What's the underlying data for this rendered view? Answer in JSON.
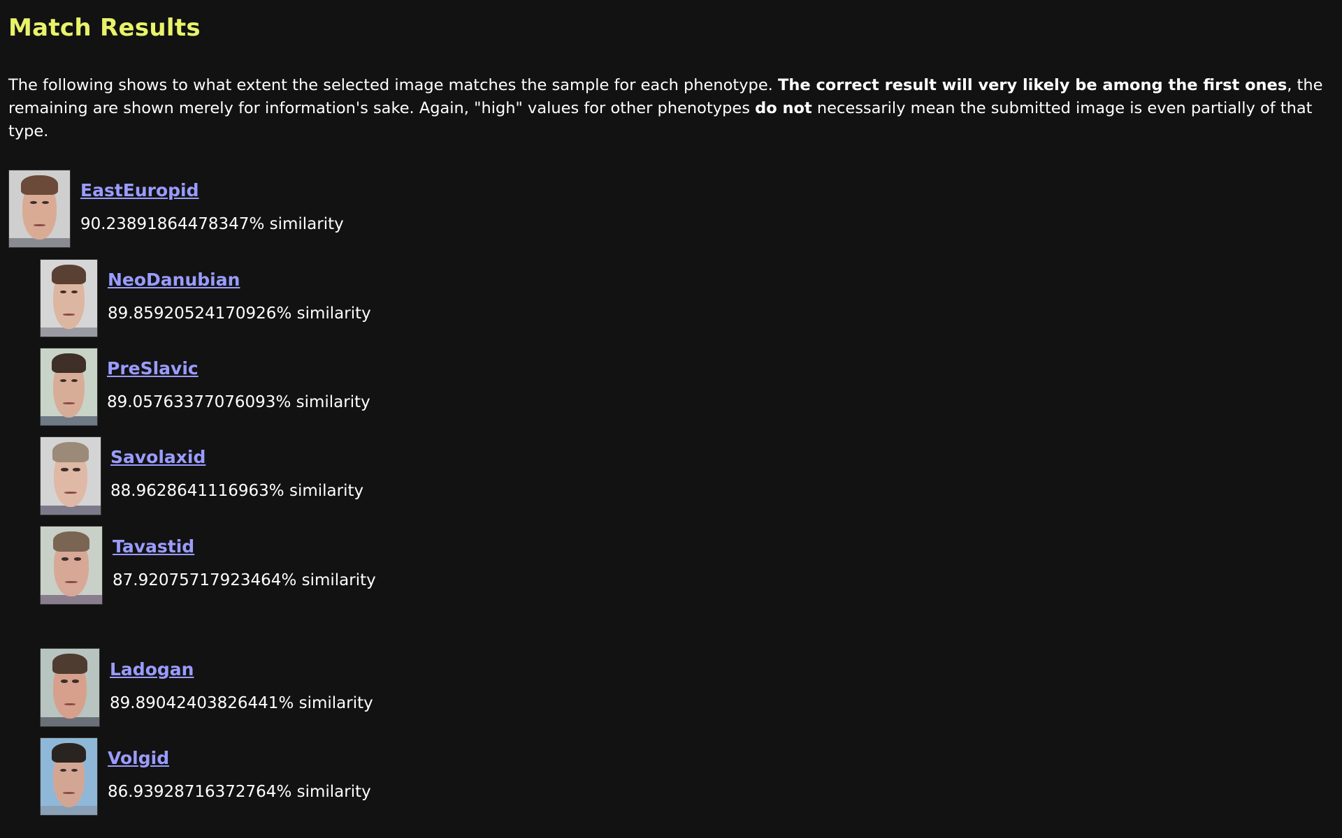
{
  "page": {
    "title": "Match Results",
    "intro": {
      "part1": "The following shows to what extent the selected image matches the sample for each phenotype. ",
      "bold1": "The correct result will very likely be among the first ones",
      "part2": ", the remaining are shown merely for information's sake. Again, \"high\" values for other phenotypes ",
      "bold2": "do not",
      "part3": " necessarily mean the submitted image is even partially of that type."
    }
  },
  "results": [
    {
      "name": "EastEuropid",
      "similarity": "90.23891864478347% similarity",
      "bg": "#cfcfcf",
      "skin": "#d9ab95",
      "hair": "#6b4a3a",
      "shirt": "#8a8a92"
    },
    {
      "name": "NeoDanubian",
      "similarity": "89.85920524170926% similarity",
      "bg": "#d6d6d6",
      "skin": "#ddb6a1",
      "hair": "#5a4033",
      "shirt": "#9a9aa2"
    },
    {
      "name": "PreSlavic",
      "similarity": "89.05763377076093% similarity",
      "bg": "#c9d4c8",
      "skin": "#d8ad98",
      "hair": "#3e3028",
      "shirt": "#6e7a86"
    },
    {
      "name": "Savolaxid",
      "similarity": "88.9628641116963% similarity",
      "bg": "#d4d4d4",
      "skin": "#e0b8a6",
      "hair": "#9b8a78",
      "shirt": "#7c7a8a"
    },
    {
      "name": "Tavastid",
      "similarity": "87.92075717923464% similarity",
      "bg": "#c8d0c8",
      "skin": "#d8a896",
      "hair": "#7a6552",
      "shirt": "#8a7e8e"
    },
    {
      "name": "Ladogan",
      "similarity": "89.89042403826441% similarity",
      "bg": "#b8c4c0",
      "skin": "#d6a08c",
      "hair": "#4e3c30",
      "shirt": "#6a6f78"
    },
    {
      "name": "Volgid",
      "similarity": "86.93928716372764% similarity",
      "bg": "#8fb8d8",
      "skin": "#d3a694",
      "hair": "#2a2420",
      "shirt": "#8aa0b6"
    }
  ]
}
